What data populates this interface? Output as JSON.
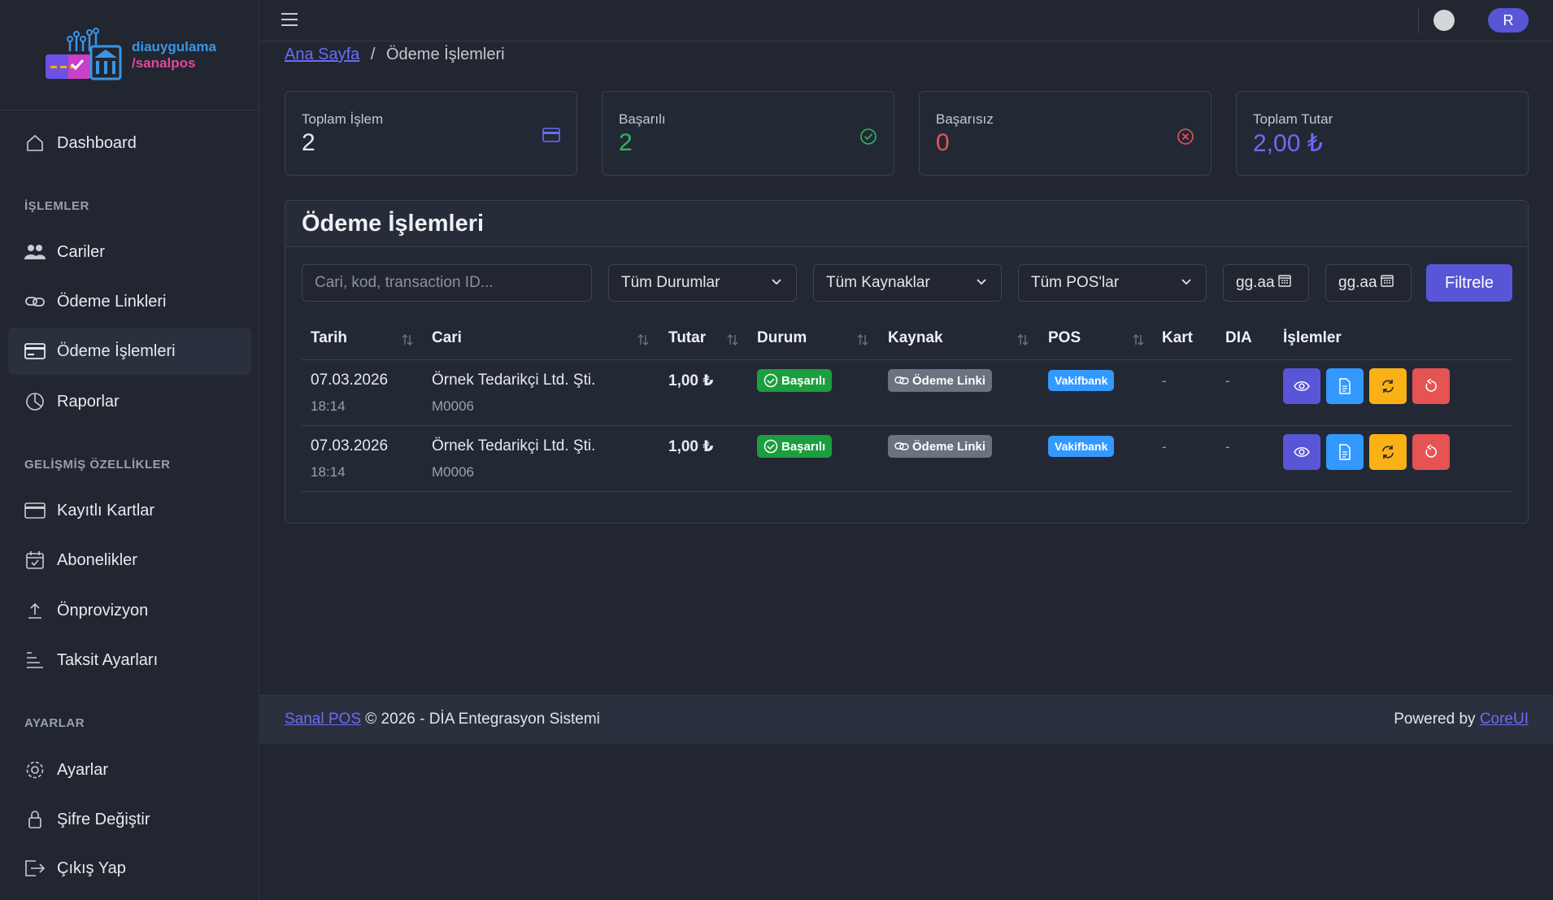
{
  "brand": {
    "line1": "diauygulama",
    "line2": "/sanalpos"
  },
  "sidebar": {
    "dashboard": "Dashboard",
    "sections": [
      {
        "title": "İŞLEMLER",
        "items": [
          "Cariler",
          "Ödeme Linkleri",
          "Ödeme İşlemleri",
          "Raporlar"
        ]
      },
      {
        "title": "GELİŞMİŞ ÖZELLİKLER",
        "items": [
          "Kayıtlı Kartlar",
          "Abonelikler",
          "Önprovizyon",
          "Taksit Ayarları"
        ]
      },
      {
        "title": "AYARLAR",
        "items": [
          "Ayarlar",
          "Şifre Değiştir",
          "Çıkış Yap"
        ]
      }
    ],
    "active_item": "Ödeme İşlemleri"
  },
  "header": {
    "avatar": "R"
  },
  "breadcrumb": {
    "home": "Ana Sayfa",
    "sep": "/",
    "current": "Ödeme İşlemleri"
  },
  "stats": [
    {
      "label": "Toplam İşlem",
      "value": "2",
      "color": "#e7e9ec"
    },
    {
      "label": "Başarılı",
      "value": "2",
      "color": "#2eb85c"
    },
    {
      "label": "Başarısız",
      "value": "0",
      "color": "#e55353"
    },
    {
      "label": "Toplam Tutar",
      "value": "2,00 ₺",
      "color": "#6b6cf5"
    }
  ],
  "card": {
    "title": "Ödeme İşlemleri"
  },
  "filters": {
    "search_placeholder": "Cari, kod, transaction ID...",
    "status": "Tüm Durumlar",
    "source": "Tüm Kaynaklar",
    "pos": "Tüm POS'lar",
    "date_from": "gg.aa",
    "date_to": "gg.aa",
    "button": "Filtrele"
  },
  "table": {
    "columns": [
      "Tarih",
      "Cari",
      "Tutar",
      "Durum",
      "Kaynak",
      "POS",
      "Kart",
      "DIA",
      "İşlemler"
    ],
    "rows": [
      {
        "date": "07.03.2026",
        "time": "18:14",
        "cari": "Örnek Tedarikçi Ltd. Şti.",
        "code": "M0006",
        "amount": "1,00 ₺",
        "status": "Başarılı",
        "source": "Ödeme Linki",
        "pos": "Vakifbank",
        "card": "-",
        "dia": "-"
      },
      {
        "date": "07.03.2026",
        "time": "18:14",
        "cari": "Örnek Tedarikçi Ltd. Şti.",
        "code": "M0006",
        "amount": "1,00 ₺",
        "status": "Başarılı",
        "source": "Ödeme Linki",
        "pos": "Vakifbank",
        "card": "-",
        "dia": "-"
      }
    ]
  },
  "footer": {
    "link": "Sanal POS",
    "text": "© 2026 - DİA Entegrasyon Sistemi",
    "powered": "Powered by",
    "powered_link": "CoreUI"
  }
}
